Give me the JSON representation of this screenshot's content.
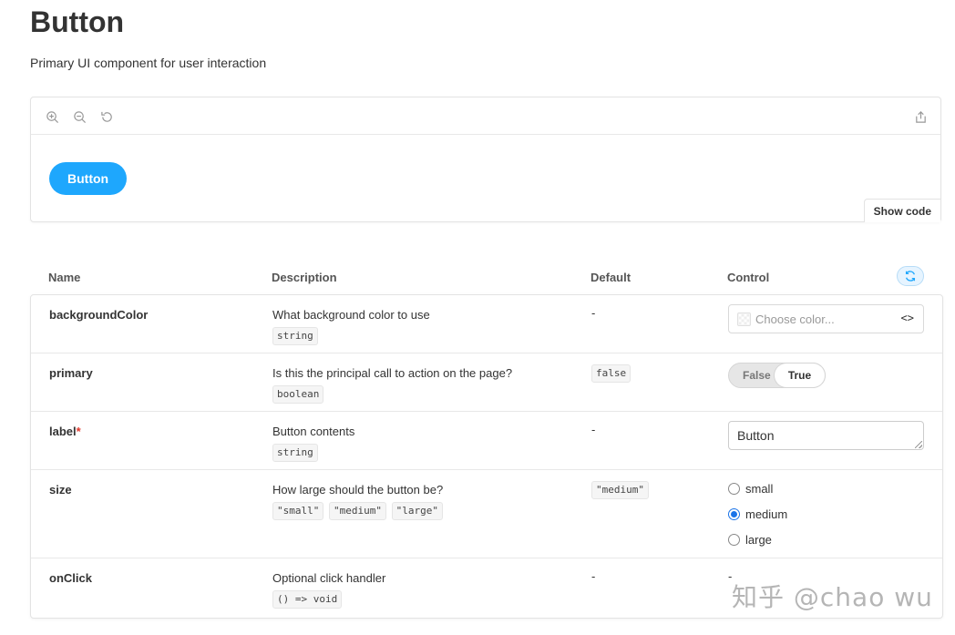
{
  "page": {
    "title": "Button",
    "subtitle": "Primary UI component for user interaction"
  },
  "canvas": {
    "preview_button_label": "Button",
    "show_code_label": "Show code",
    "tools": [
      "zoom-in-icon",
      "zoom-out-icon",
      "reset-zoom-icon",
      "share-icon"
    ]
  },
  "table": {
    "headers": {
      "name": "Name",
      "description": "Description",
      "default": "Default",
      "control": "Control"
    },
    "rows": [
      {
        "name": "backgroundColor",
        "required": false,
        "description": "What background color to use",
        "types": [
          "string"
        ],
        "default": "-",
        "control": {
          "kind": "color",
          "placeholder": "Choose color...",
          "toggle": "<>"
        }
      },
      {
        "name": "primary",
        "required": false,
        "description": "Is this the principal call to action on the page?",
        "types": [
          "boolean"
        ],
        "default": "false",
        "control": {
          "kind": "boolean",
          "false_label": "False",
          "true_label": "True",
          "value": true
        }
      },
      {
        "name": "label",
        "required": true,
        "required_mark": "*",
        "description": "Button contents",
        "types": [
          "string"
        ],
        "default": "-",
        "control": {
          "kind": "text",
          "value": "Button"
        }
      },
      {
        "name": "size",
        "required": false,
        "description": "How large should the button be?",
        "types": [
          "\"small\"",
          "\"medium\"",
          "\"large\""
        ],
        "default": "\"medium\"",
        "control": {
          "kind": "radio",
          "options": [
            "small",
            "medium",
            "large"
          ],
          "selected": "medium"
        }
      },
      {
        "name": "onClick",
        "required": false,
        "description": "Optional click handler",
        "types": [
          "() => void"
        ],
        "default": "-",
        "control": {
          "kind": "none",
          "value": "-"
        }
      }
    ]
  },
  "colors": {
    "accent": "#1ea7fd",
    "radio_checked": "#1a73e8",
    "required": "#e1372b"
  },
  "watermark": "知乎 @chao wu"
}
